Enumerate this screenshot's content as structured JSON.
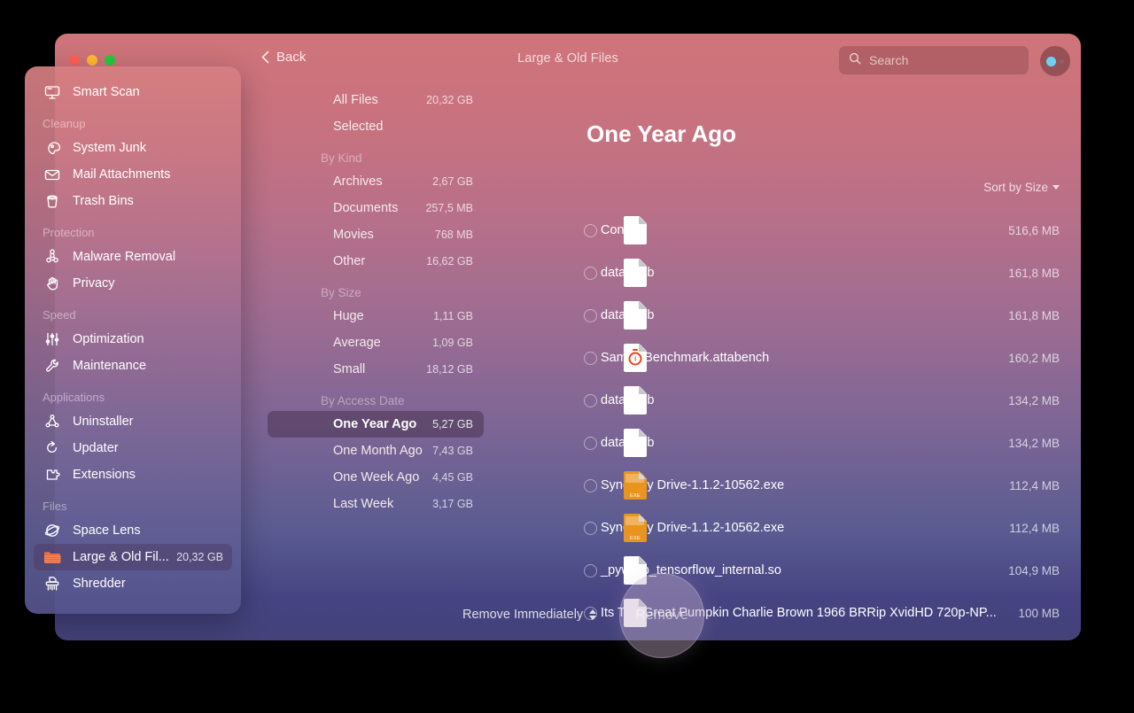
{
  "window": {
    "title": "Large & Old Files",
    "back_label": "Back"
  },
  "search": {
    "placeholder": "Search",
    "value": ""
  },
  "sidebar": {
    "groups": [
      {
        "label": "",
        "items": [
          {
            "label": "Smart Scan",
            "icon": "monitor-icon",
            "size": ""
          }
        ]
      },
      {
        "label": "Cleanup",
        "items": [
          {
            "label": "System Junk",
            "icon": "brush-icon",
            "size": ""
          },
          {
            "label": "Mail Attachments",
            "icon": "envelope-icon",
            "size": ""
          },
          {
            "label": "Trash Bins",
            "icon": "trash-bin-icon",
            "size": ""
          }
        ]
      },
      {
        "label": "Protection",
        "items": [
          {
            "label": "Malware Removal",
            "icon": "biohazard-icon",
            "size": ""
          },
          {
            "label": "Privacy",
            "icon": "hand-icon",
            "size": ""
          }
        ]
      },
      {
        "label": "Speed",
        "items": [
          {
            "label": "Optimization",
            "icon": "sliders-icon",
            "size": ""
          },
          {
            "label": "Maintenance",
            "icon": "wrench-icon",
            "size": ""
          }
        ]
      },
      {
        "label": "Applications",
        "items": [
          {
            "label": "Uninstaller",
            "icon": "molecule-icon",
            "size": ""
          },
          {
            "label": "Updater",
            "icon": "refresh-arrow-icon",
            "size": ""
          },
          {
            "label": "Extensions",
            "icon": "puzzle-piece-icon",
            "size": ""
          }
        ]
      },
      {
        "label": "Files",
        "items": [
          {
            "label": "Space Lens",
            "icon": "planet-icon",
            "size": ""
          },
          {
            "label": "Large & Old Fil...",
            "icon": "folder-icon",
            "size": "20,32 GB",
            "active": true
          },
          {
            "label": "Shredder",
            "icon": "shredder-icon",
            "size": ""
          }
        ]
      }
    ]
  },
  "filters": {
    "groups": [
      {
        "label": "",
        "items": [
          {
            "label": "All Files",
            "size": "20,32 GB"
          },
          {
            "label": "Selected",
            "size": ""
          }
        ]
      },
      {
        "label": "By Kind",
        "items": [
          {
            "label": "Archives",
            "size": "2,67 GB"
          },
          {
            "label": "Documents",
            "size": "257,5 MB"
          },
          {
            "label": "Movies",
            "size": "768 MB"
          },
          {
            "label": "Other",
            "size": "16,62 GB"
          }
        ]
      },
      {
        "label": "By Size",
        "items": [
          {
            "label": "Huge",
            "size": "1,11 GB"
          },
          {
            "label": "Average",
            "size": "1,09 GB"
          },
          {
            "label": "Small",
            "size": "18,12 GB"
          }
        ]
      },
      {
        "label": "By Access Date",
        "items": [
          {
            "label": "One Year Ago",
            "size": "5,27 GB",
            "active": true
          },
          {
            "label": "One Month Ago",
            "size": "7,43 GB"
          },
          {
            "label": "One Week Ago",
            "size": "4,45 GB"
          },
          {
            "label": "Last Week",
            "size": "3,17 GB"
          }
        ]
      }
    ]
  },
  "pane": {
    "title": "One Year Ago",
    "sort_label": "Sort by Size",
    "sort_icon": "caret-down-icon",
    "files": [
      {
        "name": "Content",
        "size": "516,6 MB",
        "icon": "document-icon",
        "checked": false
      },
      {
        "name": "data.mdb",
        "size": "161,8 MB",
        "icon": "document-icon",
        "checked": false
      },
      {
        "name": "data.mdb",
        "size": "161,8 MB",
        "icon": "document-icon",
        "checked": false
      },
      {
        "name": "SampleBenchmark.attabench",
        "size": "160,2 MB",
        "icon": "attabench-icon",
        "checked": false
      },
      {
        "name": "data.mdb",
        "size": "134,2 MB",
        "icon": "document-icon",
        "checked": false
      },
      {
        "name": "data.mdb",
        "size": "134,2 MB",
        "icon": "document-icon",
        "checked": false
      },
      {
        "name": "Synology Drive-1.1.2-10562.exe",
        "size": "112,4 MB",
        "icon": "exe-icon",
        "checked": false
      },
      {
        "name": "Synology Drive-1.1.2-10562.exe",
        "size": "112,4 MB",
        "icon": "exe-icon",
        "checked": false
      },
      {
        "name": "_pywrap_tensorflow_internal.so",
        "size": "104,9 MB",
        "icon": "document-icon",
        "checked": false
      },
      {
        "name": "Its The Great Pumpkin Charlie Brown 1966 BRRip XvidHD 720p-NP...",
        "size": "100 MB",
        "icon": "document-icon",
        "checked": false
      }
    ]
  },
  "bottom": {
    "remove_mode_label": "Remove Immediately",
    "remove_button_label": "Remove"
  },
  "colors": {
    "top_gradient": "#cf7479",
    "bottom_gradient": "#434279",
    "accent_folder": "#ef6c3e",
    "exe_icon": "#e8941f",
    "traffic_red": "#ff5f57",
    "traffic_yellow": "#febc2e",
    "traffic_green": "#28c840",
    "avatar_dot": "#6dd2f2"
  }
}
